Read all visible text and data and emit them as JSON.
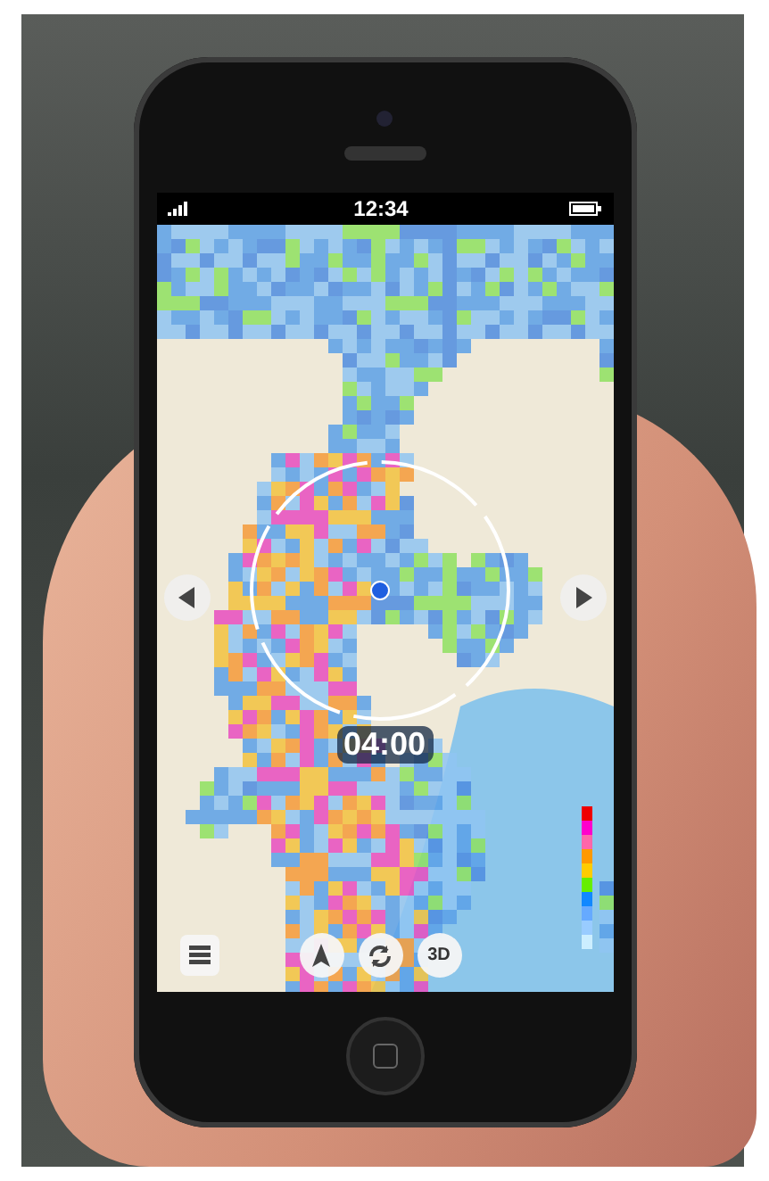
{
  "status_bar": {
    "time": "12:34"
  },
  "map": {
    "time": "04:00"
  },
  "toolbar": {
    "view_button": "3D"
  }
}
